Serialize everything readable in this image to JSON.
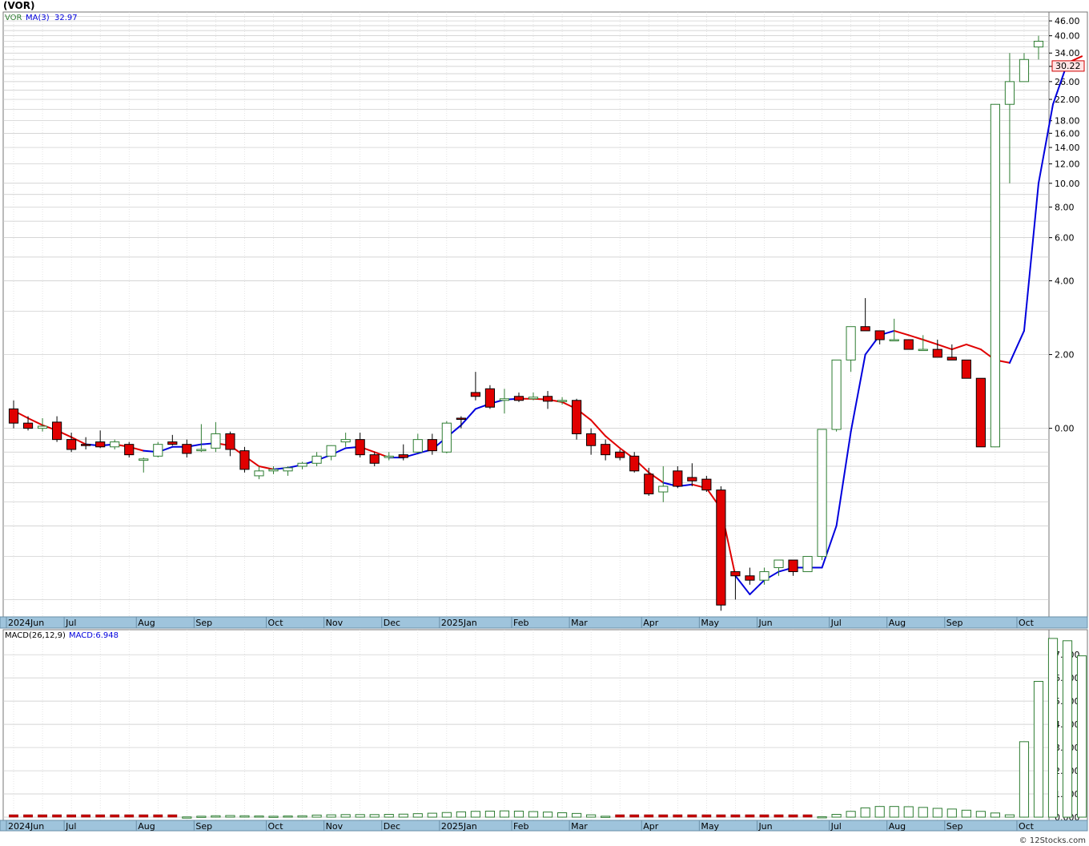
{
  "title": "(VOR)",
  "credit": "© 12Stocks.com",
  "colors": {
    "up_candle": "#2e7d32",
    "down_candle": "#e00000",
    "ma_rising": "#0000dd",
    "ma_falling": "#e00000",
    "axis_band": "#9fc4dc",
    "price_tag_bg": "#ffe4e4",
    "macd_pos": "#2e7d32",
    "macd_neg": "#cc0000",
    "grid": "#c8c8c8"
  },
  "chart_data": [
    {
      "type": "candlestick",
      "legend": {
        "symbol": "VOR",
        "ma_label": "MA(3)",
        "ma_value": "32.97"
      },
      "last_price_label": "30.22",
      "scale": "log",
      "grid": true,
      "ylim": [
        0.17,
        50
      ],
      "y_ticks": [
        "46.00",
        "40.00",
        "34.00",
        "30.00",
        "26.00",
        "22.00",
        "18.00",
        "16.00",
        "14.00",
        "12.00",
        "10.00",
        "8.00",
        "6.00",
        "4.00",
        "2.00",
        "0.00"
      ],
      "y_tick_values": [
        46,
        40,
        34,
        30,
        26,
        22,
        18,
        16,
        14,
        12,
        10,
        8,
        6,
        4,
        2,
        1
      ],
      "x_ticks": [
        {
          "label": "2024Jun",
          "index": 0
        },
        {
          "label": "Jul",
          "index": 4
        },
        {
          "label": "Aug",
          "index": 9
        },
        {
          "label": "Sep",
          "index": 13
        },
        {
          "label": "Oct",
          "index": 18
        },
        {
          "label": "Nov",
          "index": 22
        },
        {
          "label": "Dec",
          "index": 26
        },
        {
          "label": "2025Jan",
          "index": 30
        },
        {
          "label": "Feb",
          "index": 35
        },
        {
          "label": "Mar",
          "index": 39
        },
        {
          "label": "Apr",
          "index": 44
        },
        {
          "label": "May",
          "index": 48
        },
        {
          "label": "Jun",
          "index": 52
        },
        {
          "label": "Jul",
          "index": 57
        },
        {
          "label": "Aug",
          "index": 61
        },
        {
          "label": "Sep",
          "index": 65
        },
        {
          "label": "Oct",
          "index": 70
        }
      ],
      "candles": [
        [
          1.2,
          1.3,
          1.0,
          1.05
        ],
        [
          1.05,
          1.12,
          0.98,
          1.0
        ],
        [
          1.0,
          1.1,
          0.97,
          1.02
        ],
        [
          1.06,
          1.12,
          0.88,
          0.9
        ],
        [
          0.9,
          0.96,
          0.8,
          0.82
        ],
        [
          0.86,
          0.92,
          0.82,
          0.85
        ],
        [
          0.88,
          0.98,
          0.83,
          0.84
        ],
        [
          0.84,
          0.9,
          0.82,
          0.88
        ],
        [
          0.86,
          0.88,
          0.76,
          0.78
        ],
        [
          0.74,
          0.76,
          0.66,
          0.75
        ],
        [
          0.77,
          0.88,
          0.76,
          0.86
        ],
        [
          0.88,
          0.94,
          0.85,
          0.86
        ],
        [
          0.86,
          0.9,
          0.76,
          0.79
        ],
        [
          0.81,
          1.04,
          0.8,
          0.82
        ],
        [
          0.83,
          1.06,
          0.8,
          0.95
        ],
        [
          0.95,
          0.97,
          0.77,
          0.82
        ],
        [
          0.81,
          0.84,
          0.66,
          0.68
        ],
        [
          0.64,
          0.7,
          0.62,
          0.67
        ],
        [
          0.67,
          0.7,
          0.65,
          0.68
        ],
        [
          0.67,
          0.7,
          0.64,
          0.69
        ],
        [
          0.7,
          0.73,
          0.68,
          0.72
        ],
        [
          0.72,
          0.8,
          0.7,
          0.77
        ],
        [
          0.77,
          0.84,
          0.74,
          0.85
        ],
        [
          0.88,
          0.96,
          0.84,
          0.9
        ],
        [
          0.9,
          0.96,
          0.76,
          0.78
        ],
        [
          0.78,
          0.8,
          0.7,
          0.72
        ],
        [
          0.76,
          0.8,
          0.74,
          0.77
        ],
        [
          0.78,
          0.86,
          0.74,
          0.76
        ],
        [
          0.8,
          0.95,
          0.79,
          0.9
        ],
        [
          0.9,
          0.95,
          0.78,
          0.81
        ],
        [
          0.8,
          1.07,
          0.79,
          1.05
        ],
        [
          1.1,
          1.12,
          1.0,
          1.09
        ],
        [
          1.4,
          1.7,
          1.3,
          1.35
        ],
        [
          1.45,
          1.5,
          1.2,
          1.22
        ],
        [
          1.3,
          1.45,
          1.15,
          1.32
        ],
        [
          1.35,
          1.4,
          1.28,
          1.3
        ],
        [
          1.32,
          1.4,
          1.3,
          1.34
        ],
        [
          1.35,
          1.42,
          1.2,
          1.29
        ],
        [
          1.3,
          1.34,
          1.25,
          1.3
        ],
        [
          1.3,
          1.32,
          0.9,
          0.95
        ],
        [
          0.95,
          1.0,
          0.78,
          0.85
        ],
        [
          0.86,
          0.9,
          0.74,
          0.78
        ],
        [
          0.8,
          0.82,
          0.74,
          0.76
        ],
        [
          0.77,
          0.8,
          0.66,
          0.67
        ],
        [
          0.65,
          0.69,
          0.53,
          0.54
        ],
        [
          0.55,
          0.7,
          0.5,
          0.58
        ],
        [
          0.67,
          0.7,
          0.57,
          0.58
        ],
        [
          0.63,
          0.72,
          0.58,
          0.61
        ],
        [
          0.62,
          0.64,
          0.55,
          0.56
        ],
        [
          0.56,
          0.58,
          0.18,
          0.19
        ],
        [
          0.26,
          0.26,
          0.2,
          0.25
        ],
        [
          0.25,
          0.27,
          0.23,
          0.24
        ],
        [
          0.24,
          0.27,
          0.23,
          0.26
        ],
        [
          0.27,
          0.28,
          0.25,
          0.29
        ],
        [
          0.29,
          0.29,
          0.25,
          0.26
        ],
        [
          0.26,
          0.29,
          0.26,
          0.3
        ],
        [
          0.3,
          0.77,
          0.29,
          0.99
        ],
        [
          0.99,
          0.97,
          1.9,
          1.9
        ],
        [
          1.9,
          1.7,
          2.0,
          2.6
        ],
        [
          2.6,
          2.6,
          3.4,
          2.5
        ],
        [
          2.5,
          2.4,
          2.2,
          2.3
        ],
        [
          2.3,
          2.3,
          2.8,
          2.3
        ],
        [
          2.3,
          2.2,
          2.1,
          2.1
        ],
        [
          2.1,
          2.2,
          2.4,
          2.1
        ],
        [
          2.1,
          2.1,
          2.3,
          1.95
        ],
        [
          1.95,
          2.0,
          2.2,
          1.9
        ],
        [
          1.9,
          1.88,
          1.75,
          1.6
        ],
        [
          1.6,
          1.6,
          0.84,
          0.84
        ],
        [
          0.84,
          0.85,
          21,
          21
        ],
        [
          21,
          10,
          34,
          26
        ],
        [
          26,
          32,
          34,
          32
        ],
        [
          36,
          32,
          40,
          38
        ]
      ],
      "ma": [
        1.18,
        1.1,
        1.03,
        0.98,
        0.92,
        0.86,
        0.85,
        0.86,
        0.84,
        0.81,
        0.8,
        0.84,
        0.84,
        0.86,
        0.87,
        0.85,
        0.77,
        0.7,
        0.68,
        0.69,
        0.71,
        0.74,
        0.78,
        0.83,
        0.84,
        0.8,
        0.76,
        0.76,
        0.79,
        0.82,
        0.92,
        1.03,
        1.2,
        1.26,
        1.31,
        1.32,
        1.32,
        1.31,
        1.28,
        1.2,
        1.08,
        0.93,
        0.83,
        0.75,
        0.66,
        0.6,
        0.58,
        0.59,
        0.57,
        0.47,
        0.25,
        0.21,
        0.24,
        0.26,
        0.27,
        0.27,
        0.27,
        0.4,
        0.97,
        2.0,
        2.4,
        2.5,
        2.4,
        2.3,
        2.2,
        2.1,
        2.2,
        2.1,
        1.9,
        1.85,
        2.5,
        10.0,
        21.0,
        31.0,
        32.97
      ],
      "ma_rising": [
        false,
        false,
        false,
        false,
        false,
        false,
        true,
        true,
        false,
        false,
        true,
        true,
        true,
        true,
        true,
        false,
        false,
        false,
        false,
        true,
        true,
        true,
        true,
        true,
        true,
        false,
        false,
        true,
        true,
        true,
        true,
        true,
        true,
        true,
        true,
        true,
        false,
        false,
        false,
        false,
        false,
        false,
        false,
        false,
        false,
        false,
        true,
        true,
        false,
        false,
        false,
        true,
        true,
        true,
        true,
        true,
        true,
        true,
        true,
        true,
        true,
        true,
        false,
        false,
        false,
        false,
        false,
        false,
        false,
        false,
        true,
        true,
        true,
        true,
        false
      ]
    },
    {
      "type": "bar",
      "legend": {
        "name": "MACD(26,12,9)",
        "value_label": "MACD:6.948"
      },
      "ylim": [
        0,
        7.8
      ],
      "grid": true,
      "y_ticks": [
        "7.000",
        "6.000",
        "5.000",
        "4.000",
        "3.000",
        "2.000",
        "1.000",
        "0.000"
      ],
      "y_tick_values": [
        7,
        6,
        5,
        4,
        3,
        2,
        1,
        0
      ],
      "x_ticks": [
        {
          "label": "2024Jun",
          "index": 0
        },
        {
          "label": "Jul",
          "index": 4
        },
        {
          "label": "Aug",
          "index": 9
        },
        {
          "label": "Sep",
          "index": 13
        },
        {
          "label": "Oct",
          "index": 18
        },
        {
          "label": "Nov",
          "index": 22
        },
        {
          "label": "Dec",
          "index": 26
        },
        {
          "label": "2025Jan",
          "index": 30
        },
        {
          "label": "Feb",
          "index": 35
        },
        {
          "label": "Mar",
          "index": 39
        },
        {
          "label": "Apr",
          "index": 44
        },
        {
          "label": "May",
          "index": 48
        },
        {
          "label": "Jun",
          "index": 52
        },
        {
          "label": "Jul",
          "index": 57
        },
        {
          "label": "Aug",
          "index": 61
        },
        {
          "label": "Sep",
          "index": 65
        },
        {
          "label": "Oct",
          "index": 70
        }
      ],
      "values": [
        -0.08,
        -0.08,
        -0.08,
        -0.08,
        -0.06,
        -0.06,
        -0.06,
        -0.06,
        -0.05,
        -0.05,
        -0.03,
        -0.02,
        0.01,
        0.04,
        0.06,
        0.07,
        0.06,
        0.05,
        0.04,
        0.05,
        0.06,
        0.09,
        0.1,
        0.11,
        0.11,
        0.11,
        0.12,
        0.13,
        0.15,
        0.17,
        0.2,
        0.23,
        0.25,
        0.26,
        0.27,
        0.26,
        0.24,
        0.22,
        0.19,
        0.16,
        0.1,
        0.04,
        -0.02,
        -0.04,
        -0.06,
        -0.08,
        -0.1,
        -0.12,
        -0.13,
        -0.15,
        -0.15,
        -0.16,
        -0.15,
        -0.14,
        -0.12,
        -0.08,
        0.02,
        0.12,
        0.25,
        0.4,
        0.46,
        0.46,
        0.45,
        0.42,
        0.38,
        0.35,
        0.3,
        0.25,
        0.18,
        0.1,
        3.25,
        5.85,
        7.7,
        7.6,
        6.95
      ]
    }
  ]
}
